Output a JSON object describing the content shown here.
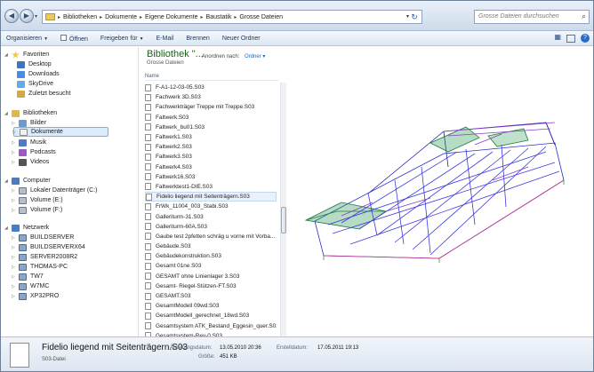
{
  "address": {
    "back": "◀",
    "forward": "▶",
    "recent": "▾",
    "breadcrumbs": [
      "Bibliotheken",
      "Dokumente",
      "Eigene Dokumente",
      "Baustatik",
      "Grosse Dateien"
    ],
    "crumb_sep": "▸",
    "dropdown": "▾",
    "refresh": "↻",
    "search_placeholder": "Grosse Dateien durchsuchen",
    "search_icon": "⌕"
  },
  "toolbar": {
    "organize": "Organisieren",
    "open": "Öffnen",
    "share": "Freigeben für",
    "email": "E-Mail",
    "burn": "Brennen",
    "new_folder": "Neuer Ordner",
    "view": "▦",
    "help": "?"
  },
  "nav": {
    "favorites_header": "Favoriten",
    "favorites": [
      "Desktop",
      "Downloads",
      "SkyDrive",
      "Zuletzt besucht"
    ],
    "libraries_header": "Bibliotheken",
    "libraries": [
      "Bilder",
      "Dokumente",
      "Musik",
      "Podcasts",
      "Videos"
    ],
    "computer_header": "Computer",
    "drives": [
      "Lokaler Datenträger (C:)",
      "Volume (E:)",
      "Volume (F:)"
    ],
    "network_header": "Netzwerk",
    "network": [
      "BUILDSERVER",
      "BUILDSERVERX64",
      "SERVER2008R2",
      "THOMAS-PC",
      "TW7",
      "W7MC",
      "XP32PRO"
    ]
  },
  "content": {
    "library_title": "Bibliothek \"...",
    "library_subtitle": "Grosse Dateien",
    "arrange_by": "Anordnen nach:",
    "arrange_value": "Ordner",
    "column_name": "Name",
    "files": [
      "F-A1-12-03-05.S03",
      "Fachwerk 3D.S03",
      "Fachwerkträger Treppe mit Treppe.S03",
      "Faltwerk.S03",
      "Faltwerk_bu01.S03",
      "Faltwerk1.S03",
      "Faltwerk2.S03",
      "Faltwerk3.S03",
      "Faltwerk4.S03",
      "Faltwerk16.S03",
      "Faltwerktest1-DIE.S03",
      "Fidelio liegend mit Seitenträgern.S03",
      "FrWk_11004_003_Stabi.S03",
      "Galleriturm-31.S03",
      "Galleriturm-60A.S03",
      "Gaube test 2pfetten schräg u vorne mit Vorba...",
      "Gebäude.S03",
      "Gebäudekonstruktion.S03",
      "Gesamt 01ne.S03",
      "GESAMT ohne Linienlager 3.S03",
      "Gesamt- Riegel-Stützen-FT.S03",
      "GESAMT.S03",
      "GesamtModell 09wd.S03",
      "GesamtModell_gerechnet_18wd.S03",
      "Gesamtsystem ATK_Bestand_Eggesin_quer.S03",
      "Gesamtsystem-Rev-0.S03"
    ],
    "selected_index": 11
  },
  "details": {
    "name": "Fidelio liegend mit Seitenträgern.S03",
    "type": "S03-Datei",
    "modified_label": "Änderungsdatum:",
    "modified": "13.05.2010 20:36",
    "size_label": "Größe:",
    "size": "451 KB",
    "created_label": "Erstelldatum:",
    "created": "17.05.2011 19:13"
  }
}
